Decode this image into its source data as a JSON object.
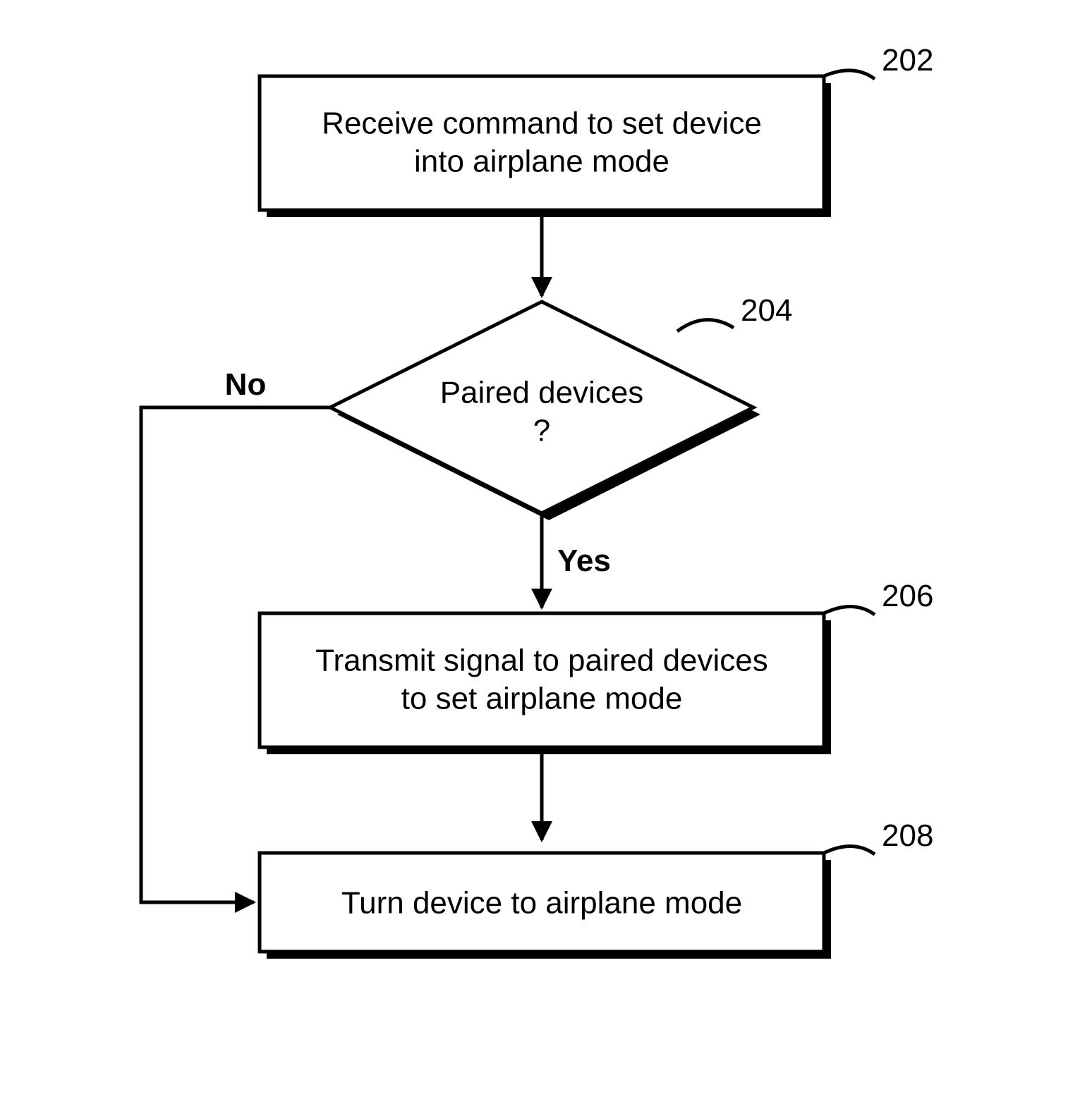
{
  "nodes": {
    "n202": {
      "ref": "202",
      "line1": "Receive command to set device",
      "line2": "into airplane mode"
    },
    "n204": {
      "ref": "204",
      "line1": "Paired devices",
      "line2": "?"
    },
    "n206": {
      "ref": "206",
      "line1": "Transmit signal to paired devices",
      "line2": "to set airplane mode"
    },
    "n208": {
      "ref": "208",
      "line1": "Turn device to airplane mode"
    }
  },
  "edges": {
    "no": "No",
    "yes": "Yes"
  }
}
